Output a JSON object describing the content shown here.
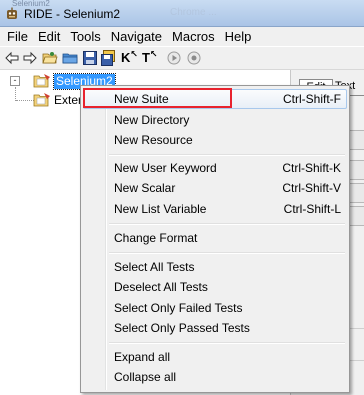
{
  "window": {
    "title": "RIDE - Selenium2",
    "background_title_fragment": "Selenium2",
    "background_title_blur": "Chrome ...",
    "colors": {
      "selection": "#3399ff",
      "highlight_box": "#e8232e",
      "menu_bg": "#f0f0f0"
    }
  },
  "menubar": {
    "items": [
      "File",
      "Edit",
      "Tools",
      "Navigate",
      "Macros",
      "Help"
    ]
  },
  "toolbar": {
    "buttons": [
      "back-arrow-icon",
      "forward-arrow-icon",
      "open-folder-icon",
      "folder-icon",
      "save-icon",
      "save-all-icon",
      "keyword-icon",
      "testcase-icon",
      "run-icon",
      "stop-icon"
    ],
    "keyword_glyph": "K",
    "testcase_glyph": "T"
  },
  "tree": {
    "expander": "-",
    "root": "Selenium2",
    "child": "Exter"
  },
  "right_pane": {
    "edit_tab": "Edit",
    "text_tab": "Text"
  },
  "context_menu": {
    "groups": [
      [
        {
          "label": "New Suite",
          "shortcut": "Ctrl-Shift-F"
        },
        {
          "label": "New Directory",
          "shortcut": ""
        },
        {
          "label": "New Resource",
          "shortcut": ""
        }
      ],
      [
        {
          "label": "New User Keyword",
          "shortcut": "Ctrl-Shift-K"
        },
        {
          "label": "New Scalar",
          "shortcut": "Ctrl-Shift-V"
        },
        {
          "label": "New List Variable",
          "shortcut": "Ctrl-Shift-L"
        }
      ],
      [
        {
          "label": "Change Format",
          "shortcut": ""
        }
      ],
      [
        {
          "label": "Select All Tests",
          "shortcut": ""
        },
        {
          "label": "Deselect All Tests",
          "shortcut": ""
        },
        {
          "label": "Select Only Failed Tests",
          "shortcut": ""
        },
        {
          "label": "Select Only Passed Tests",
          "shortcut": ""
        }
      ],
      [
        {
          "label": "Expand all",
          "shortcut": ""
        },
        {
          "label": "Collapse all",
          "shortcut": ""
        }
      ]
    ]
  }
}
